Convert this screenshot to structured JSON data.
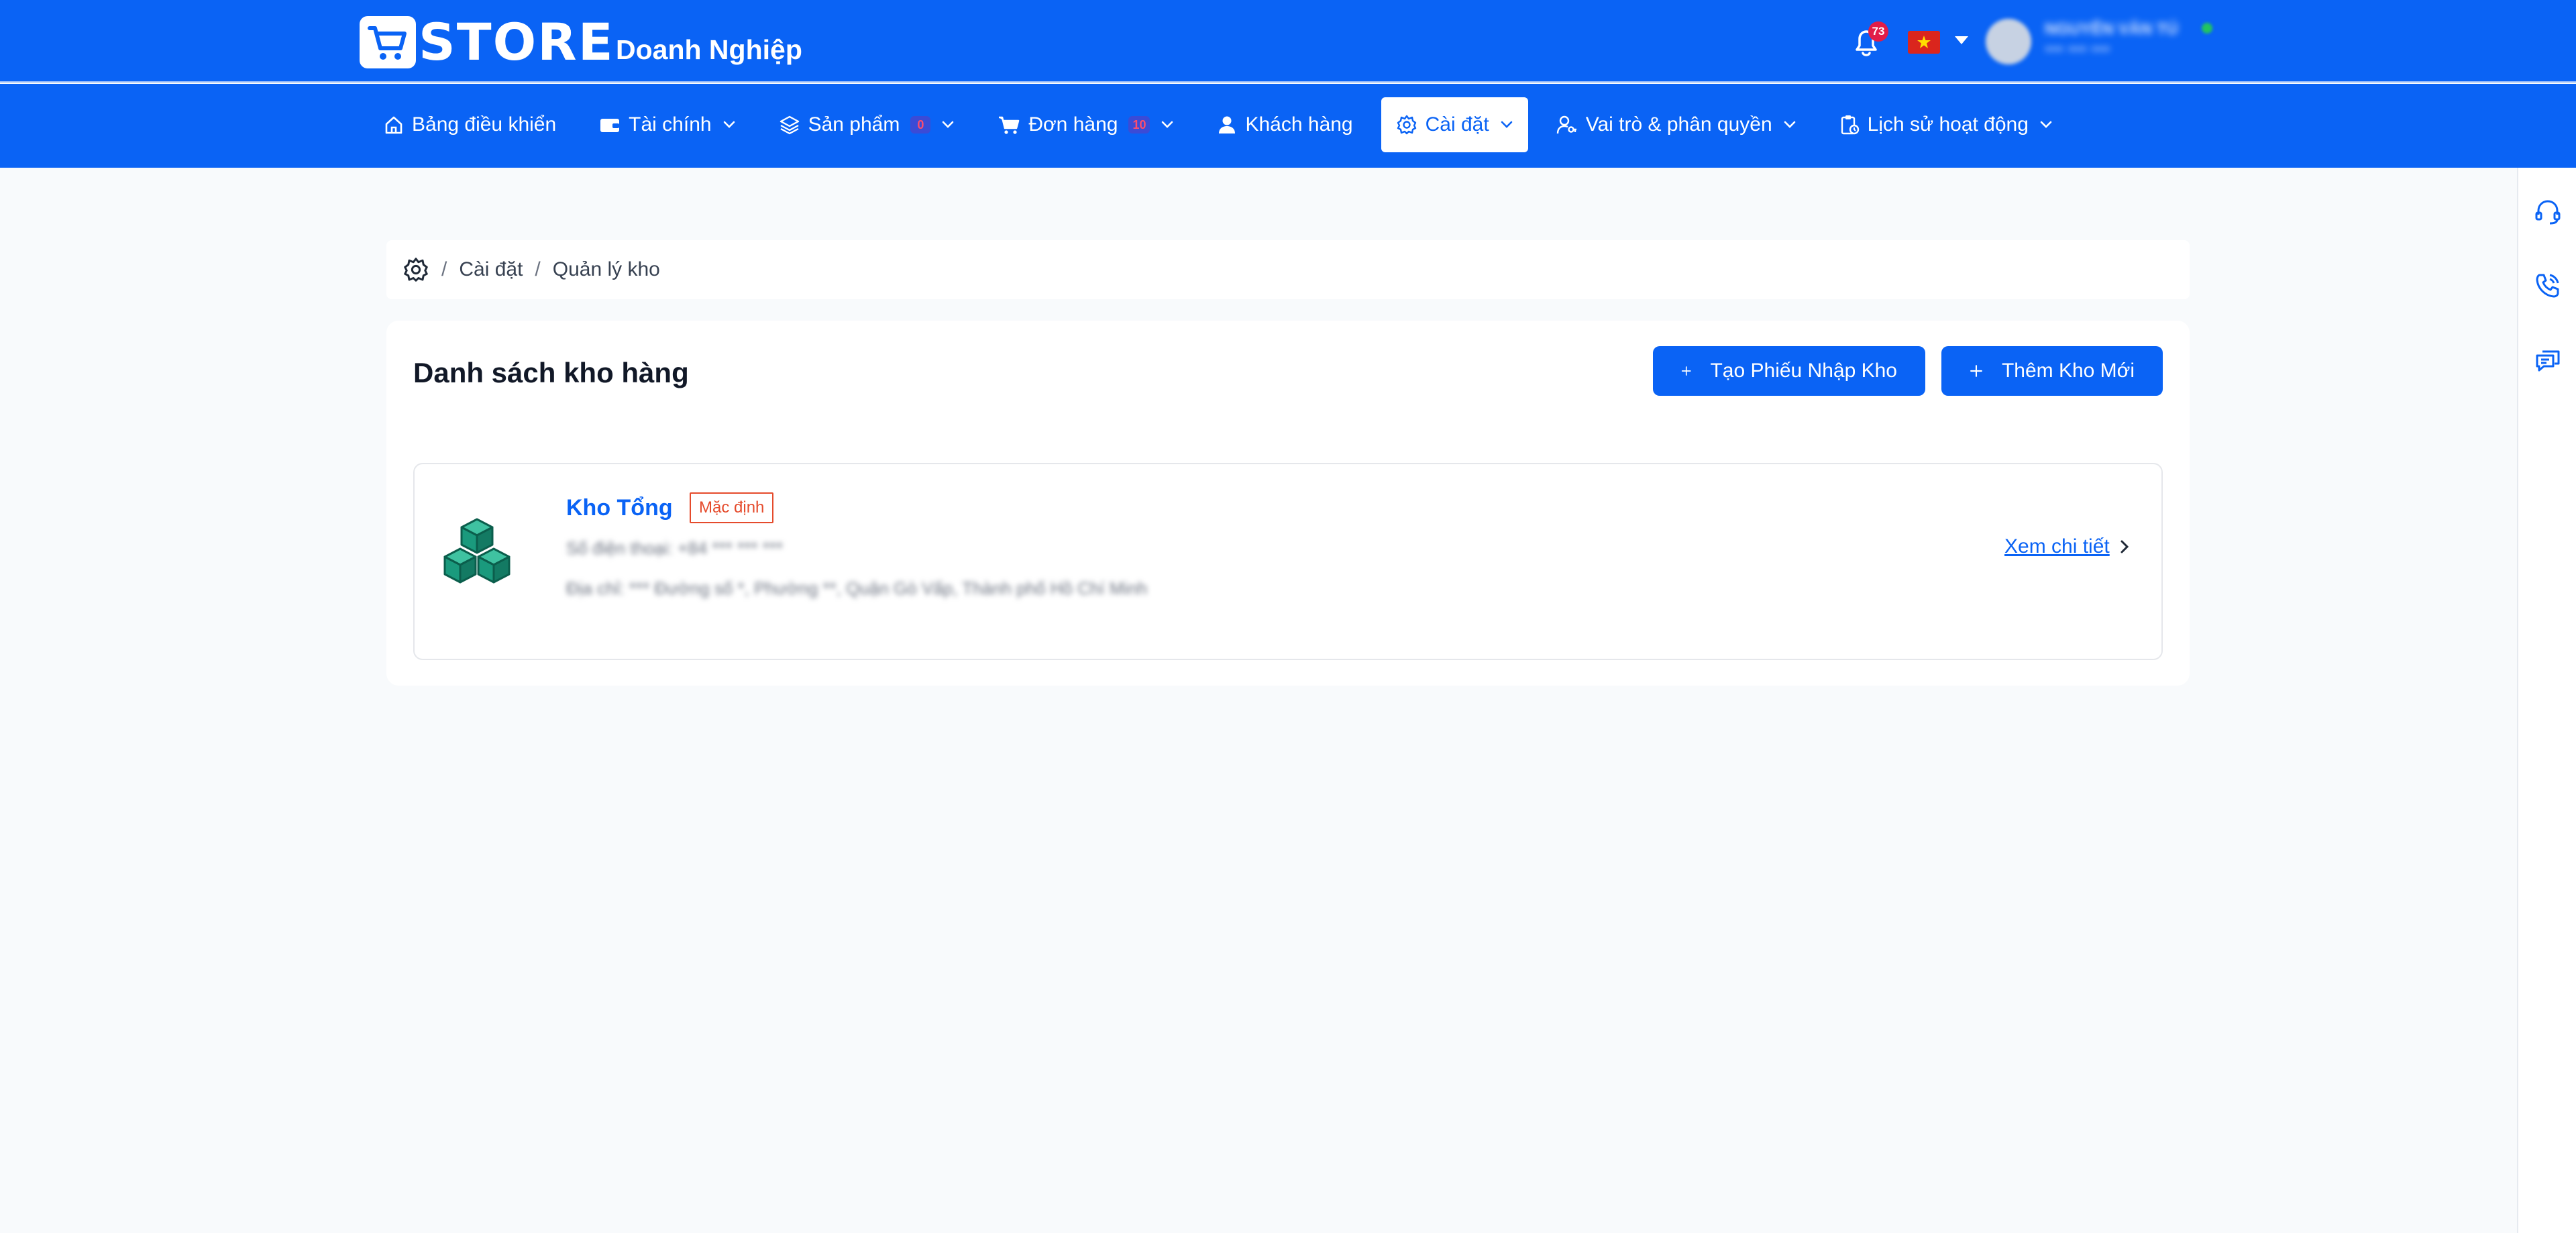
{
  "header": {
    "logo_text": "STORE",
    "brand_sub": "Doanh Nghiệp",
    "notification_count": "73",
    "user_name": "NGUYỄN VĂN TÚ",
    "user_phone": "*** *** ***"
  },
  "nav": {
    "items": [
      {
        "label": "Bảng điều khiển"
      },
      {
        "label": "Tài chính"
      },
      {
        "label": "Sản phẩm",
        "badge": "0"
      },
      {
        "label": "Đơn hàng",
        "badge": "10"
      },
      {
        "label": "Khách hàng"
      },
      {
        "label": "Cài đặt"
      },
      {
        "label": "Vai trò & phân quyền"
      },
      {
        "label": "Lịch sử hoạt động"
      }
    ],
    "active": "Cài đặt"
  },
  "breadcrumb": {
    "items": [
      "Cài đặt",
      "Quản lý kho"
    ]
  },
  "main": {
    "title": "Danh sách kho hàng",
    "buttons": {
      "create_import": "Tạo Phiếu Nhập Kho",
      "add_warehouse": "Thêm Kho Mới"
    },
    "warehouses": [
      {
        "name": "Kho Tổng",
        "badge": "Mặc định",
        "phone": "Số điện thoại: +84 *** *** ***",
        "address": "Địa chỉ: *** Đường số *, Phường **, Quận Gò Vấp, Thành phố Hồ Chí Minh",
        "link": "Xem chi tiết"
      }
    ]
  },
  "colors": {
    "primary": "#0a63f5",
    "badge_default": "#e54b2c",
    "warehouse_icon": "#1a9a7d"
  }
}
